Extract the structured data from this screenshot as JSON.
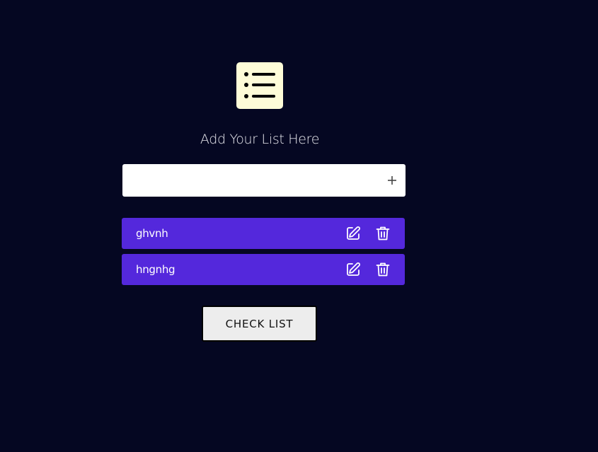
{
  "header": {
    "logo_icon": "list-icon",
    "title": "Add Your List Here"
  },
  "input": {
    "value": "",
    "placeholder": "",
    "add_icon": "plus-icon"
  },
  "items": [
    {
      "label": "ghvnh",
      "edit_icon": "edit-icon",
      "delete_icon": "trash-icon"
    },
    {
      "label": "hngnhg",
      "edit_icon": "edit-icon",
      "delete_icon": "trash-icon"
    }
  ],
  "actions": {
    "check_list_label": "CHECK LIST"
  },
  "colors": {
    "background": "#050722",
    "logo_bg": "#fefcd8",
    "item_bg": "#5428dc",
    "button_bg": "#ededed"
  }
}
